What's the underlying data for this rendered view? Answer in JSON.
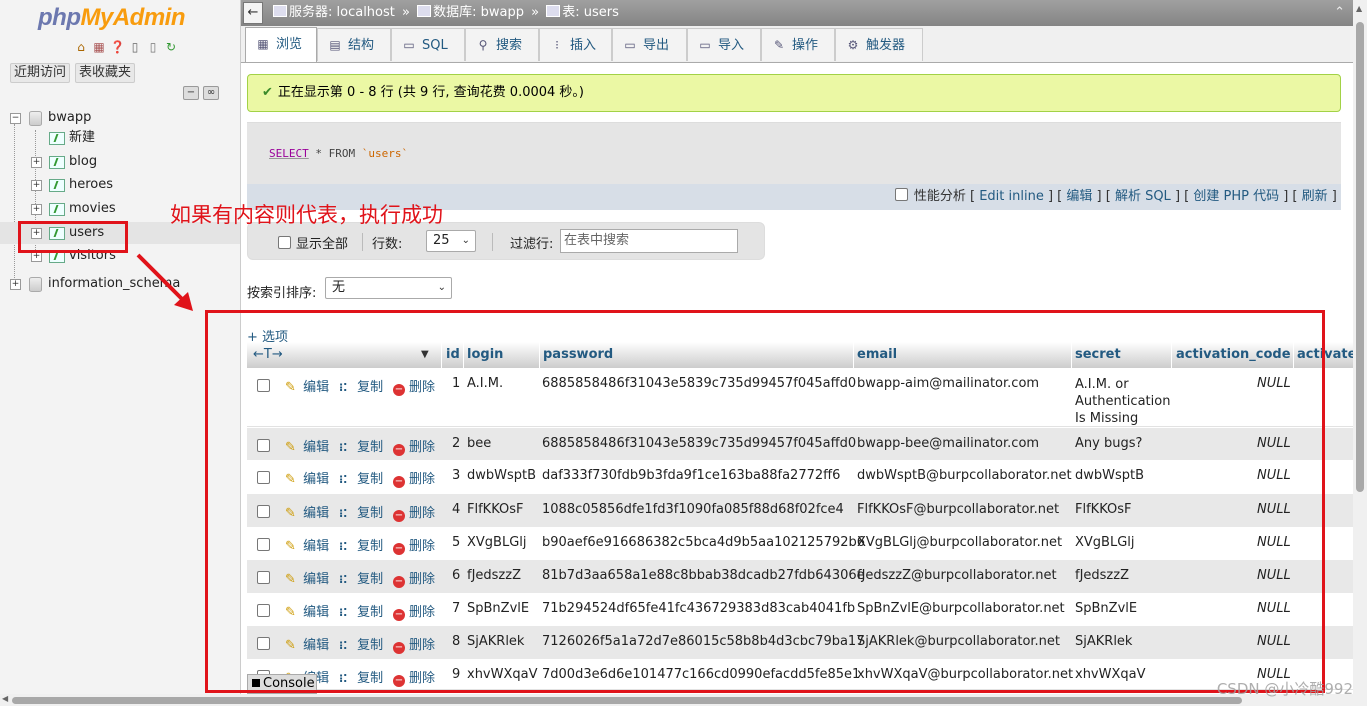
{
  "logo": {
    "part1": "php",
    "part2": "MyAdmin"
  },
  "nav": {
    "recent_label": "近期访问",
    "favorites_label": "表收藏夹",
    "tree": [
      {
        "label": "bwapp"
      },
      {
        "label": "新建"
      },
      {
        "label": "blog"
      },
      {
        "label": "heroes"
      },
      {
        "label": "movies"
      },
      {
        "label": "users"
      },
      {
        "label": "visitors"
      },
      {
        "label": "information_schema"
      }
    ]
  },
  "topbar": {
    "server": "服务器: localhost",
    "database": "数据库: bwapp",
    "table": "表: users",
    "sep": "»"
  },
  "tabs": [
    {
      "label": "浏览",
      "icon": "table-browse-icon",
      "glyph": "▦"
    },
    {
      "label": "结构",
      "icon": "structure-icon",
      "glyph": "▤"
    },
    {
      "label": "SQL",
      "icon": "sql-icon",
      "glyph": "▭"
    },
    {
      "label": "搜索",
      "icon": "search-icon",
      "glyph": "⚲"
    },
    {
      "label": "插入",
      "icon": "insert-icon",
      "glyph": "⁝"
    },
    {
      "label": "导出",
      "icon": "export-icon",
      "glyph": "▭"
    },
    {
      "label": "导入",
      "icon": "import-icon",
      "glyph": "▭"
    },
    {
      "label": "操作",
      "icon": "wrench-icon",
      "glyph": "✎"
    },
    {
      "label": "触发器",
      "icon": "trigger-icon",
      "glyph": "⚙"
    }
  ],
  "success_message": "正在显示第 0 - 8 行 (共 9 行, 查询花费 0.0004 秒。)",
  "sql": {
    "select": "SELECT",
    "rest": " * FROM ",
    "table": "`users`"
  },
  "sql_links": {
    "profiling": "性能分析",
    "edit_inline": "Edit inline",
    "edit": "编辑",
    "explain": "解析 SQL",
    "create_php": "创建 PHP 代码",
    "refresh": "刷新"
  },
  "navbar": {
    "show_all": "显示全部",
    "rows_label": "行数:",
    "rows_value": "25",
    "filter_label": "过滤行:",
    "filter_placeholder": "在表中搜索"
  },
  "sort": {
    "label": "按索引排序:",
    "value": "无"
  },
  "options_link": "+ 选项",
  "columns": [
    "id",
    "login",
    "password",
    "email",
    "secret",
    "activation_code",
    "activated"
  ],
  "row_actions": {
    "edit": "编辑",
    "copy": "复制",
    "delete": "删除"
  },
  "rows": [
    {
      "id": "1",
      "login": "A.I.M.",
      "password": "6885858486f31043e5839c735d99457f045affd0",
      "email": "bwapp-aim@mailinator.com",
      "secret": "A.I.M. or Authentication Is Missing",
      "activation_code": "NULL"
    },
    {
      "id": "2",
      "login": "bee",
      "password": "6885858486f31043e5839c735d99457f045affd0",
      "email": "bwapp-bee@mailinator.com",
      "secret": "Any bugs?",
      "activation_code": "NULL"
    },
    {
      "id": "3",
      "login": "dwbWsptB",
      "password": "daf333f730fdb9b3fda9f1ce163ba88fa2772ff6",
      "email": "dwbWsptB@burpcollaborator.net",
      "secret": "dwbWsptB",
      "activation_code": "NULL"
    },
    {
      "id": "4",
      "login": "FlfKKOsF",
      "password": "1088c05856dfe1fd3f1090fa085f88d68f02fce4",
      "email": "FlfKKOsF@burpcollaborator.net",
      "secret": "FlfKKOsF",
      "activation_code": "NULL"
    },
    {
      "id": "5",
      "login": "XVgBLGlj",
      "password": "b90aef6e916686382c5bca4d9b5aa102125792b6",
      "email": "XVgBLGlj@burpcollaborator.net",
      "secret": "XVgBLGlj",
      "activation_code": "NULL"
    },
    {
      "id": "6",
      "login": "fJedszzZ",
      "password": "81b7d3aa658a1e88c8bbab38dcadb27fdb64306e",
      "email": "fJedszzZ@burpcollaborator.net",
      "secret": "fJedszzZ",
      "activation_code": "NULL"
    },
    {
      "id": "7",
      "login": "SpBnZvlE",
      "password": "71b294524df65fe41fc436729383d83cab4041fb",
      "email": "SpBnZvlE@burpcollaborator.net",
      "secret": "SpBnZvlE",
      "activation_code": "NULL"
    },
    {
      "id": "8",
      "login": "SjAKRlek",
      "password": "7126026f5a1a72d7e86015c58b8b4d3cbc79ba17",
      "email": "SjAKRlek@burpcollaborator.net",
      "secret": "SjAKRlek",
      "activation_code": "NULL"
    },
    {
      "id": "9",
      "login": "xhvWXqaV",
      "password": "7d00d3e6d6e101477c166cd0990efacdd5fe85e1",
      "email": "xhvWXqaV@burpcollaborator.net",
      "secret": "xhvWXqaV",
      "activation_code": "NULL"
    }
  ],
  "console_label": "Console",
  "annotation_text": "如果有内容则代表，执行成功",
  "watermark": "CSDN @小冷酷992",
  "colors": {
    "annotation": "#e0131a",
    "link": "#235a81",
    "success_bg": "#ebf8a4"
  }
}
